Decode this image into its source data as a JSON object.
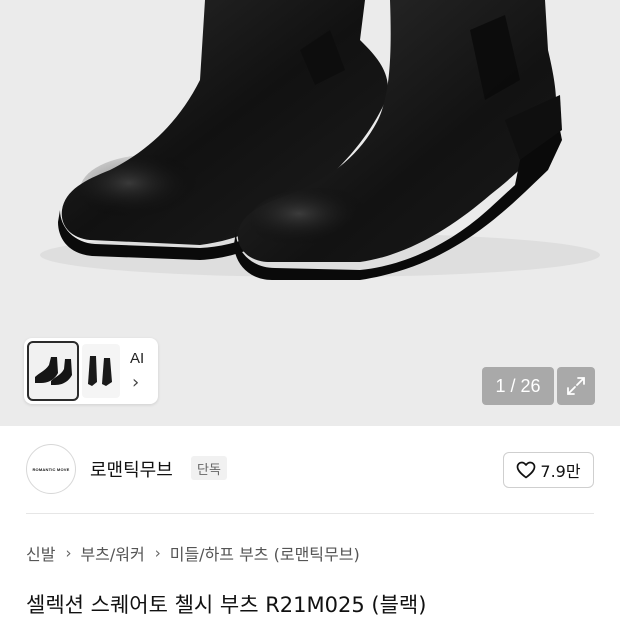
{
  "gallery": {
    "thumbnail_ai_label": "AI",
    "counter": "1 / 26",
    "icons": {
      "expand": "expand-icon",
      "chevron": "chevron-right-icon"
    }
  },
  "brand": {
    "logo_text": "ROMANTIC MOVE",
    "name": "로맨틱무브",
    "badge": "단독",
    "like_count": "7.9만",
    "like_icon": "heart-outline-icon"
  },
  "breadcrumb": {
    "items": [
      "신발",
      "부츠/워커",
      "미들/하프 부츠 (로맨틱무브)"
    ]
  },
  "product": {
    "title": "셀렉션 스퀘어토 첼시 부츠 R21M025 (블랙)"
  },
  "colors": {
    "hero_bg": "#ebebeb",
    "counter_bg": "#a9a9a9",
    "boot_black": "#141414"
  }
}
